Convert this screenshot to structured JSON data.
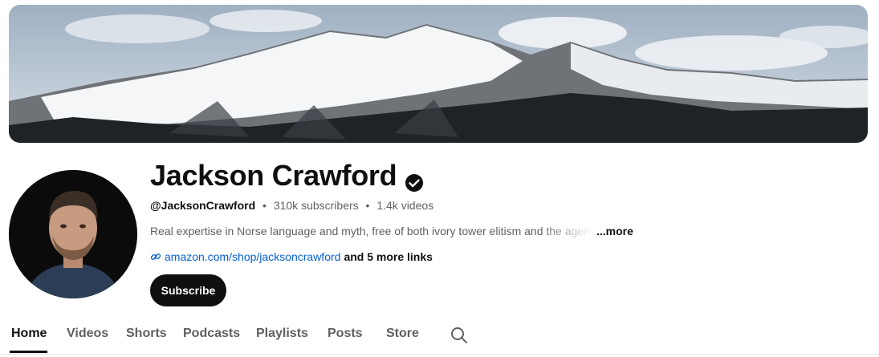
{
  "channel": {
    "name": "Jackson Crawford",
    "handle": "@JacksonCrawford",
    "subscribers": "310k subscribers",
    "videos": "1.4k videos",
    "separator": "•",
    "description": "Real expertise in Norse language and myth, free of both ivory tower elitism and the agenda",
    "more_label": "...more",
    "link_url": "amazon.com/shop/jacksoncrawford",
    "more_links": "and 5 more links",
    "subscribe_label": "Subscribe"
  },
  "tabs": [
    {
      "label": "Home",
      "active": true
    },
    {
      "label": "Videos",
      "active": false
    },
    {
      "label": "Shorts",
      "active": false
    },
    {
      "label": "Podcasts",
      "active": false
    },
    {
      "label": "Playlists",
      "active": false
    },
    {
      "label": "Posts",
      "active": false
    },
    {
      "label": "Store",
      "active": false
    }
  ],
  "icons": {
    "verified": "verified-check-icon",
    "link": "link-icon",
    "search": "search-icon"
  },
  "colors": {
    "link": "#065fd4",
    "button": "#0f0f0f",
    "muted_text": "#606060"
  }
}
